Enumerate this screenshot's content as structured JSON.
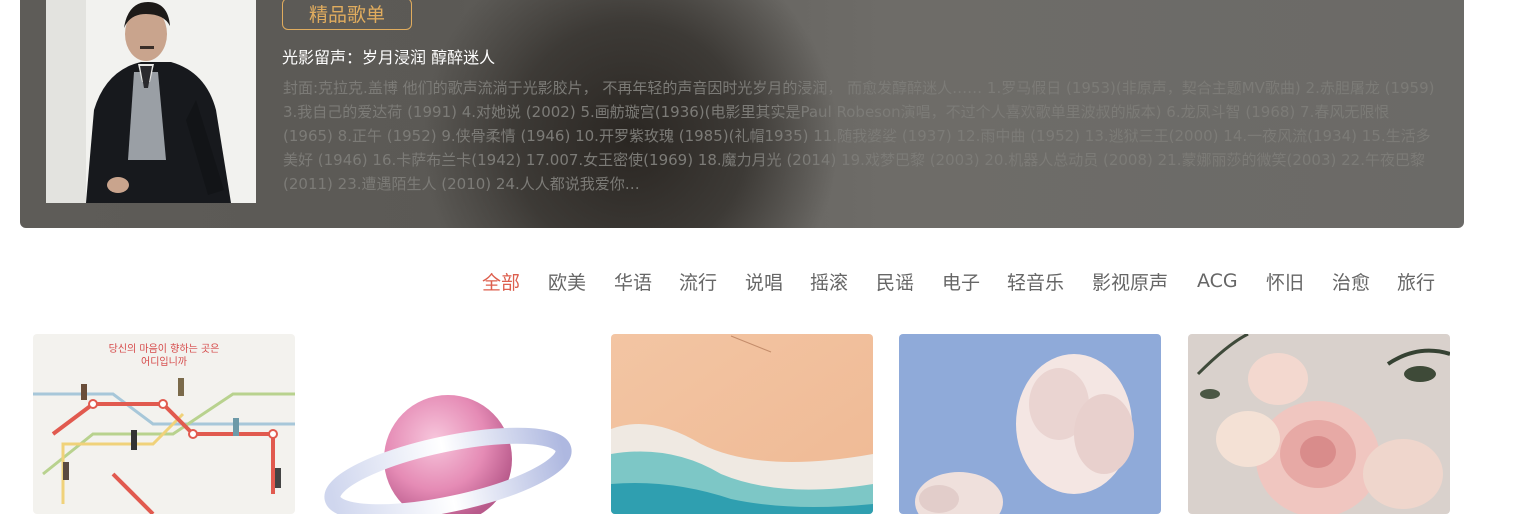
{
  "banner": {
    "tag_label": "精品歌单",
    "title": "光影留声：岁月浸润 醇醉迷人",
    "description": "封面:克拉克.盖博 他们的歌声流淌于光影胶片， 不再年轻的声音因时光岁月的浸润， 而愈发醇醉迷人…… 1.罗马假日 (1953)(非原声，契合主题MV歌曲) 2.赤胆屠龙 (1959) 3.我自己的爱达荷 (1991) 4.对她说 (2002) 5.画舫璇宫(1936)(电影里其实是Paul Robeson演唱，不过个人喜欢歌单里波叔的版本) 6.龙凤斗智 (1968) 7.春风无限恨(1965) 8.正午 (1952) 9.侠骨柔情 (1946) 10.开罗紫玫瑰 (1985)(礼帽1935) 11.随我婆娑 (1937) 12.雨中曲 (1952) 13.逃狱三王(2000) 14.一夜风流(1934) 15.生活多美好 (1946) 16.卡萨布兰卡(1942) 17.007.女王密使(1969) 18.魔力月光 (2014) 19.戏梦巴黎 (2003) 20.机器人总动员 (2008) 21.蒙娜丽莎的微笑(2003) 22.午夜巴黎 (2011) 23.遭遇陌生人 (2010) 24.人人都说我爱你…",
    "cover_icon": "playlist-cover-portrait"
  },
  "categories": {
    "items": [
      "全部",
      "欧美",
      "华语",
      "流行",
      "说唱",
      "摇滚",
      "民谣",
      "电子",
      "轻音乐",
      "影视原声",
      "ACG",
      "怀旧",
      "治愈",
      "旅行"
    ],
    "active_index": 0
  },
  "cards": {
    "first_card_caption_line1": "당신의 마음이 향하는 곳은",
    "first_card_caption_line2": "어디입니까"
  },
  "colors": {
    "accent_active_tab": "#dd5f4e",
    "tag_gold": "#e0ac5e",
    "tab_text": "#666666"
  }
}
